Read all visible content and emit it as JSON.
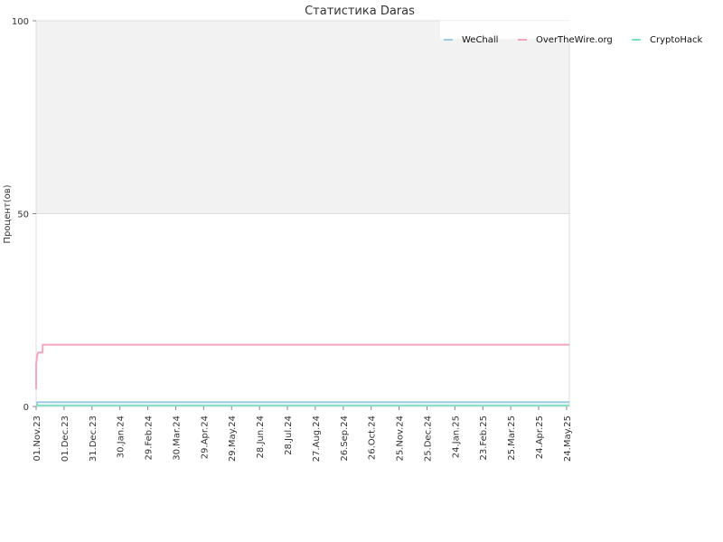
{
  "chart_data": {
    "type": "line",
    "title": "Статистика Daras",
    "ylabel": "Процент(ов)",
    "xlabel": "",
    "ylim": [
      0,
      100
    ],
    "yticks": [
      0,
      50,
      100
    ],
    "x_start": "2023-11-01",
    "x_end": "2025-05-27",
    "xticks": [
      {
        "date": "2023-11-01",
        "label": "01.Nov.23"
      },
      {
        "date": "2023-12-01",
        "label": "01.Dec.23"
      },
      {
        "date": "2023-12-31",
        "label": "31.Dec.23"
      },
      {
        "date": "2024-01-30",
        "label": "30.Jan.24"
      },
      {
        "date": "2024-02-29",
        "label": "29.Feb.24"
      },
      {
        "date": "2024-03-30",
        "label": "30.Mar.24"
      },
      {
        "date": "2024-04-29",
        "label": "29.Apr.24"
      },
      {
        "date": "2024-05-29",
        "label": "29.May.24"
      },
      {
        "date": "2024-06-28",
        "label": "28.Jun.24"
      },
      {
        "date": "2024-07-28",
        "label": "28.Jul.24"
      },
      {
        "date": "2024-08-27",
        "label": "27.Aug.24"
      },
      {
        "date": "2024-09-26",
        "label": "26.Sep.24"
      },
      {
        "date": "2024-10-26",
        "label": "26.Oct.24"
      },
      {
        "date": "2024-11-25",
        "label": "25.Nov.24"
      },
      {
        "date": "2024-12-25",
        "label": "25.Dec.24"
      },
      {
        "date": "2025-01-24",
        "label": "24.Jan.25"
      },
      {
        "date": "2025-02-23",
        "label": "23.Feb.25"
      },
      {
        "date": "2025-03-25",
        "label": "25.Mar.25"
      },
      {
        "date": "2025-04-24",
        "label": "24.Apr.25"
      },
      {
        "date": "2025-05-24",
        "label": "24.May.25"
      }
    ],
    "grid": true,
    "legend_position": "top-right",
    "series": [
      {
        "name": "WeChall",
        "color": "#9ecae1",
        "points": [
          {
            "x": "2023-11-02",
            "y": 0
          },
          {
            "x": "2023-11-02",
            "y": 1.1
          },
          {
            "x": "2025-05-27",
            "y": 1.1
          }
        ]
      },
      {
        "name": "OverTheWire.org",
        "color": "#f4a6c0",
        "points": [
          {
            "x": "2023-11-01",
            "y": 4.5
          },
          {
            "x": "2023-11-01",
            "y": 11
          },
          {
            "x": "2023-11-02",
            "y": 13
          },
          {
            "x": "2023-11-03",
            "y": 14
          },
          {
            "x": "2023-11-08",
            "y": 14
          },
          {
            "x": "2023-11-08",
            "y": 16
          },
          {
            "x": "2025-05-27",
            "y": 16
          }
        ]
      },
      {
        "name": "CryptoHack",
        "color": "#7fe0c8",
        "points": [
          {
            "x": "2023-11-01",
            "y": 0.3
          },
          {
            "x": "2025-05-27",
            "y": 0.3
          }
        ]
      }
    ]
  }
}
